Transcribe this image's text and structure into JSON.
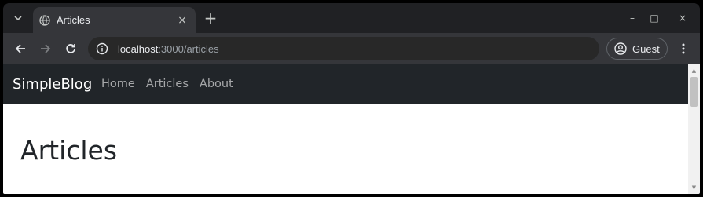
{
  "browser": {
    "tab": {
      "title": "Articles",
      "close_glyph": "×"
    },
    "new_tab_glyph": "+",
    "window_controls": {
      "minimize": "–",
      "maximize": "□",
      "close": "×"
    },
    "address": {
      "host": "localhost",
      "rest": ":3000/articles"
    },
    "profile_label": "Guest",
    "icons": {
      "tab_search": "chevron-down-icon",
      "favicon": "globe-icon",
      "back": "arrow-left-icon",
      "forward": "arrow-right-icon",
      "reload": "reload-icon",
      "site_info": "info-icon",
      "profile": "account-circle-icon",
      "menu": "kebab-menu-icon"
    }
  },
  "page": {
    "brand": "SimpleBlog",
    "nav": [
      {
        "label": "Home"
      },
      {
        "label": "Articles"
      },
      {
        "label": "About"
      }
    ],
    "heading": "Articles"
  },
  "colors": {
    "navbar_bg": "#212529",
    "chrome_bg": "#202124",
    "toolbar_bg": "#35363a"
  }
}
